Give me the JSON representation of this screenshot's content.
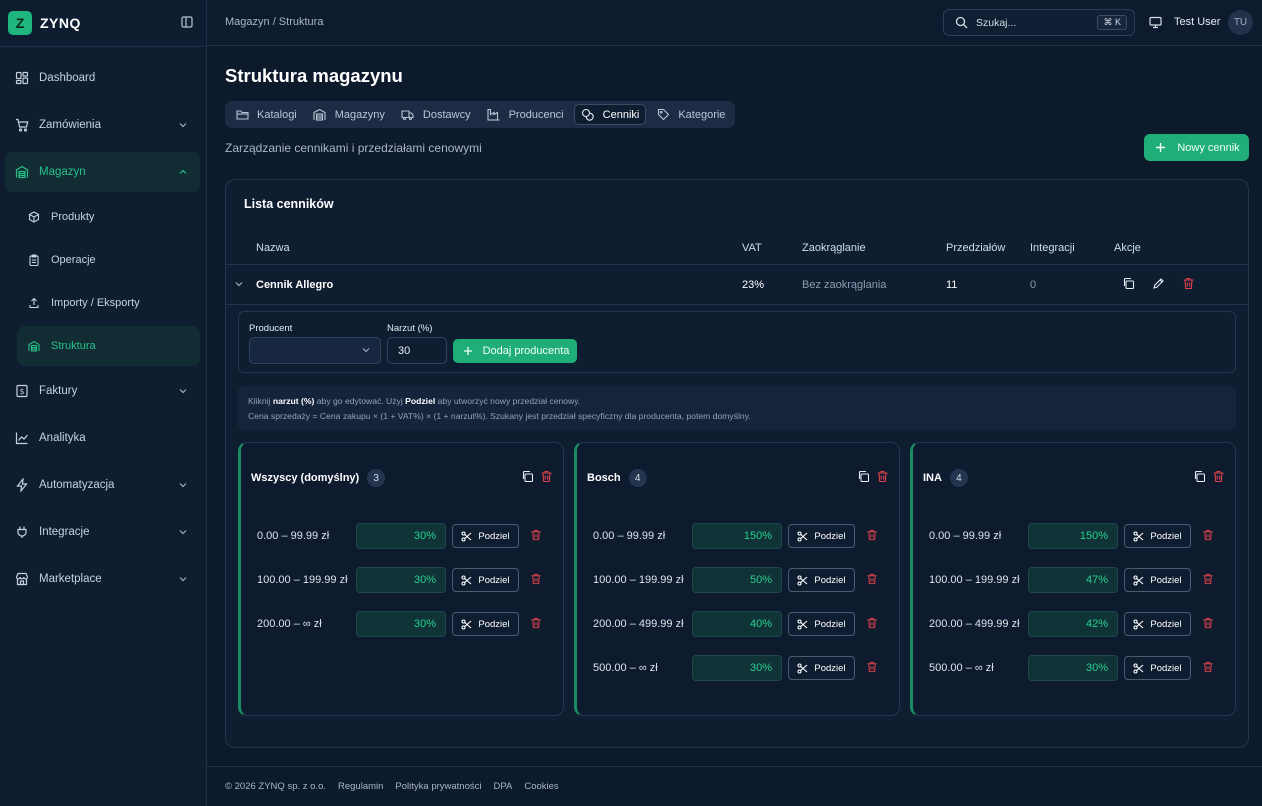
{
  "brand": {
    "logo_letter": "Z",
    "name": "ZYNQ"
  },
  "sidebar": {
    "items": [
      {
        "label": "Dashboard",
        "icon": "grid-icon"
      },
      {
        "label": "Zamówienia",
        "icon": "cart-icon"
      },
      {
        "label": "Magazyn",
        "icon": "warehouse-icon"
      },
      {
        "label": "Faktury",
        "icon": "invoice-icon"
      },
      {
        "label": "Analityka",
        "icon": "chart-icon"
      },
      {
        "label": "Automatyzacja",
        "icon": "bolt-icon"
      },
      {
        "label": "Integracje",
        "icon": "plug-icon"
      },
      {
        "label": "Marketplace",
        "icon": "store-icon"
      }
    ],
    "magazyn_sub": [
      {
        "label": "Produkty",
        "icon": "box-icon"
      },
      {
        "label": "Operacje",
        "icon": "clipboard-icon"
      },
      {
        "label": "Importy / Eksporty",
        "icon": "upload-icon"
      },
      {
        "label": "Struktura",
        "icon": "warehouse-icon"
      }
    ]
  },
  "topbar": {
    "breadcrumb": "Magazyn / Struktura",
    "search_placeholder": "Szukaj...",
    "search_shortcut": "⌘ K",
    "user_name": "Test User",
    "user_initials": "TU"
  },
  "page": {
    "title": "Struktura magazynu",
    "subtitle": "Zarządzanie cennikami i przedziałami cenowymi",
    "new_button": "Nowy cennik",
    "tabs": [
      {
        "label": "Katalogi",
        "icon": "folder-icon"
      },
      {
        "label": "Magazyny",
        "icon": "warehouse-icon"
      },
      {
        "label": "Dostawcy",
        "icon": "truck-icon"
      },
      {
        "label": "Producenci",
        "icon": "factory-icon"
      },
      {
        "label": "Cenniki",
        "icon": "coins-icon"
      },
      {
        "label": "Kategorie",
        "icon": "tag-icon"
      }
    ],
    "active_tab": "Cenniki"
  },
  "pricelists": {
    "card_title": "Lista cenników",
    "columns": [
      "Nazwa",
      "VAT",
      "Zaokrąglanie",
      "Przedziałów",
      "Integracji",
      "Akcje"
    ],
    "row": {
      "name": "Cennik Allegro",
      "vat": "23%",
      "rounding": "Bez zaokrąglania",
      "ranges": "11",
      "integrations": "0"
    },
    "form": {
      "producer_label": "Producent",
      "producer_value": "",
      "markup_label": "Narzut (%)",
      "markup_value": "30",
      "add_button": "Dodaj producenta"
    },
    "info": {
      "l1_a": "Kliknij ",
      "l1_b": "narzut (%)",
      "l1_c": " aby go edytować. Użyj ",
      "l1_d": "Podziel",
      "l1_e": " aby utworzyć nowy przedział cenowy.",
      "l2": "Cena sprzedaży = Cena zakupu × (1 + VAT%) × (1 + narzut%). Szukany jest przedział specyficzny dla producenta, potem domyślny."
    },
    "split_label": "Podziel",
    "groups": [
      {
        "name": "Wszyscy (domyślny)",
        "count": "3",
        "rows": [
          {
            "range": "0.00 – 99.99 zł",
            "markup": "30%"
          },
          {
            "range": "100.00 – 199.99 zł",
            "markup": "30%"
          },
          {
            "range": "200.00 – ∞ zł",
            "markup": "30%"
          }
        ]
      },
      {
        "name": "Bosch",
        "count": "4",
        "rows": [
          {
            "range": "0.00 – 99.99 zł",
            "markup": "150%"
          },
          {
            "range": "100.00 – 199.99 zł",
            "markup": "50%"
          },
          {
            "range": "200.00 – 499.99 zł",
            "markup": "40%"
          },
          {
            "range": "500.00 – ∞ zł",
            "markup": "30%"
          }
        ]
      },
      {
        "name": "INA",
        "count": "4",
        "rows": [
          {
            "range": "0.00 – 99.99 zł",
            "markup": "150%"
          },
          {
            "range": "100.00 – 199.99 zł",
            "markup": "47%"
          },
          {
            "range": "200.00 – 499.99 zł",
            "markup": "42%"
          },
          {
            "range": "500.00 – ∞ zł",
            "markup": "30%"
          }
        ]
      }
    ]
  },
  "footer": {
    "copyright": "© 2026 ZYNQ sp. z o.o.",
    "links": [
      "Regulamin",
      "Polityka prywatności",
      "DPA",
      "Cookies"
    ]
  },
  "colors": {
    "accent": "#1fae78",
    "danger": "#e0404b",
    "background": "#0d1a2c"
  }
}
